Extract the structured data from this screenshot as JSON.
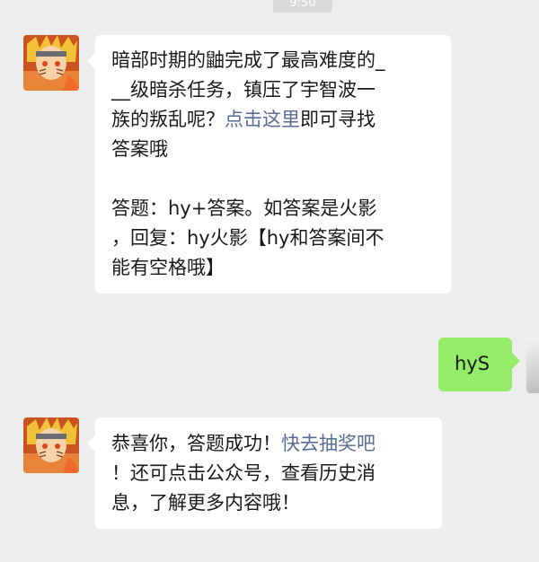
{
  "chat": {
    "timestamp": "9:50",
    "messages": [
      {
        "sender": "official-account",
        "lines": [
          "暗部时期的鼬完成了最高难度的_",
          "__级暗杀任务，镇压了宇智波一",
          "族的叛乱呢？",
          "即可寻找",
          "答案哦"
        ],
        "link_text": "点击这里",
        "lines2": [
          "答题：hy+答案。如答案是火影",
          "，回复：hy火影【hy和答案间不",
          "能有空格哦】"
        ]
      },
      {
        "sender": "user",
        "text": "hyS"
      },
      {
        "sender": "official-account",
        "line1": "恭喜你，答题成功！",
        "link_text": "快去抽奖吧",
        "lines": [
          "！还可点击公众号，查看历史消",
          "息，了解更多内容哦！"
        ]
      }
    ]
  },
  "colors": {
    "background": "#ededed",
    "received_bubble": "#ffffff",
    "sent_bubble": "#95ec69",
    "link": "#576b95"
  },
  "icons": {
    "official_avatar": "naruto-avatar-icon",
    "user_avatar": "user-avatar-icon"
  }
}
